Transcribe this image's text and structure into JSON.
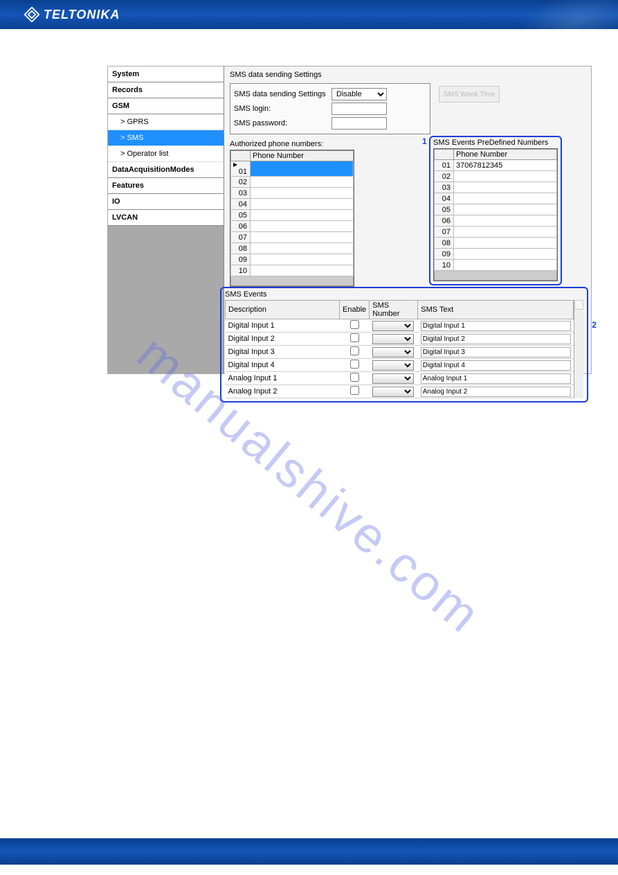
{
  "brand": "TELTONIKA",
  "watermark": "manualshive.com",
  "sidebar": {
    "items": [
      {
        "label": "System",
        "type": "main"
      },
      {
        "label": "Records",
        "type": "main"
      },
      {
        "label": "GSM",
        "type": "main"
      },
      {
        "label": "> GPRS",
        "type": "sub"
      },
      {
        "label": "> SMS",
        "type": "sub",
        "active": true
      },
      {
        "label": "> Operator list",
        "type": "sub"
      },
      {
        "label": "DataAcquisitionModes",
        "type": "main"
      },
      {
        "label": "Features",
        "type": "main"
      },
      {
        "label": "IO",
        "type": "main"
      },
      {
        "label": "LVCAN",
        "type": "main"
      }
    ]
  },
  "panel": {
    "title": "SMS data sending Settings",
    "settings_label": "SMS data sending Settings",
    "settings_value": "Disable",
    "login_label": "SMS login:",
    "login_value": "",
    "password_label": "SMS password:",
    "password_value": "",
    "week_button": "SMS Week Time"
  },
  "authorized": {
    "title": "Authorized phone numbers:",
    "header_idx": "",
    "header_phone": "Phone Number",
    "rows": [
      {
        "idx": "01",
        "val": ""
      },
      {
        "idx": "02",
        "val": ""
      },
      {
        "idx": "03",
        "val": ""
      },
      {
        "idx": "04",
        "val": ""
      },
      {
        "idx": "05",
        "val": ""
      },
      {
        "idx": "06",
        "val": ""
      },
      {
        "idx": "07",
        "val": ""
      },
      {
        "idx": "08",
        "val": ""
      },
      {
        "idx": "09",
        "val": ""
      },
      {
        "idx": "10",
        "val": ""
      }
    ]
  },
  "predefined": {
    "title": "SMS Events PreDefined Numbers",
    "header_phone": "Phone Number",
    "rows": [
      {
        "idx": "01",
        "val": "37067812345"
      },
      {
        "idx": "02",
        "val": ""
      },
      {
        "idx": "03",
        "val": ""
      },
      {
        "idx": "04",
        "val": ""
      },
      {
        "idx": "05",
        "val": ""
      },
      {
        "idx": "06",
        "val": ""
      },
      {
        "idx": "07",
        "val": ""
      },
      {
        "idx": "08",
        "val": ""
      },
      {
        "idx": "09",
        "val": ""
      },
      {
        "idx": "10",
        "val": ""
      }
    ],
    "callout": "1"
  },
  "events": {
    "title": "SMS Events",
    "headers": {
      "desc": "Description",
      "enable": "Enable",
      "num": "SMS Number",
      "text": "SMS Text"
    },
    "rows": [
      {
        "desc": "Digital Input 1",
        "text": "Digital Input 1"
      },
      {
        "desc": "Digital Input 2",
        "text": "Digital Input 2"
      },
      {
        "desc": "Digital Input 3",
        "text": "Digital Input 3"
      },
      {
        "desc": "Digital Input 4",
        "text": "Digital Input 4"
      },
      {
        "desc": "Analog Input 1",
        "text": "Analog Input 1"
      },
      {
        "desc": "Analog Input 2",
        "text": "Analog Input 2"
      }
    ],
    "callout": "2"
  }
}
